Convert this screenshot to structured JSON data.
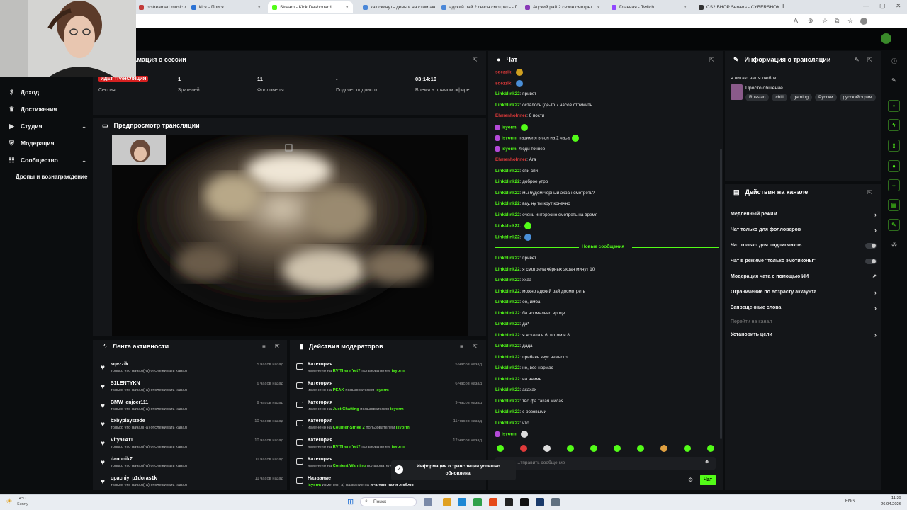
{
  "browser": {
    "tabs": [
      {
        "label": "p streamed music ×",
        "color": "#c23b3b"
      },
      {
        "label": "kick - Поиск",
        "color": "#2b72d4"
      },
      {
        "label": "Stream - Kick Dashboard",
        "color": "#53fc18",
        "active": true
      },
      {
        "label": "как скинуть деньги на стим акку",
        "color": "#4a87d8"
      },
      {
        "label": "адский рай 2 сезон смотреть - П",
        "color": "#4a87d8"
      },
      {
        "label": "Адский рай 2 сезон смотрет",
        "color": "#8a3bb8"
      },
      {
        "label": "Главная - Twitch",
        "color": "#9146ff"
      },
      {
        "label": "CS2 BHOP Servers - CYBERSHOKE",
        "color": "#333333"
      }
    ],
    "new_tab": "+"
  },
  "sidebar": {
    "items": [
      {
        "label": "Доход",
        "icon": "coin-icon"
      },
      {
        "label": "Достижения",
        "icon": "trophy-icon"
      },
      {
        "label": "Студия",
        "icon": "studio-icon",
        "expandable": true
      },
      {
        "label": "Модерация",
        "icon": "shield-icon"
      },
      {
        "label": "Сообщество",
        "icon": "people-icon",
        "expandable": true
      },
      {
        "label": "Дропы и вознаграждение",
        "icon": ""
      }
    ],
    "partial_hidden": "...трансляции"
  },
  "session": {
    "title": "...мация о сессии",
    "live_badge": "ИДЕТ ТРАНСЛЯЦИЯ",
    "stats": [
      {
        "value": "",
        "label": "Сессия"
      },
      {
        "value": "1",
        "label": "Зрителей"
      },
      {
        "value": "11",
        "label": "Фолловеры"
      },
      {
        "value": "-",
        "label": "Подсчет подписок"
      },
      {
        "value": "03:14:10",
        "label": "Время в прямом эфире"
      }
    ]
  },
  "preview": {
    "title": "Предпросмотр трансляции"
  },
  "activity": {
    "title": "Лента активности",
    "rows": [
      {
        "name": "sqezzik",
        "sub": "только что начал(-а) отслеживать канал",
        "time": "5 часов назад"
      },
      {
        "name": "S1LENTYKN",
        "sub": "только что начал(-а) отслеживать канал",
        "time": "6 часов назад"
      },
      {
        "name": "BMW_enjoer111",
        "sub": "только что начал(-а) отслеживать канал",
        "time": "9 часов назад"
      },
      {
        "name": "bxbyplaystede",
        "sub": "только что начал(-а) отслеживать канал",
        "time": "10 часов назад"
      },
      {
        "name": "Vitya1411",
        "sub": "только что начал(-а) отслеживать канал",
        "time": "10 часов назад"
      },
      {
        "name": "danonik7",
        "sub": "только что начал(-а) отслеживать канал",
        "time": "11 часов назад"
      },
      {
        "name": "opacniy_p1doras1k",
        "sub": "только что начал(-а) отслеживать канал",
        "time": "11 часов назад"
      }
    ]
  },
  "moderators": {
    "title": "Действия модераторов",
    "rows": [
      {
        "name": "Категория",
        "pre": "изменено на ",
        "val": "RV There Yet?",
        "mid": " пользователем ",
        "user": "isyorm",
        "time": "5 часов назад"
      },
      {
        "name": "Категория",
        "pre": "изменено на ",
        "val": "PEAK",
        "mid": " пользователем ",
        "user": "isyorm",
        "time": "6 часов назад"
      },
      {
        "name": "Категория",
        "pre": "изменено на ",
        "val": "Just Chatting",
        "mid": " пользователем ",
        "user": "isyorm",
        "time": "9 часов назад"
      },
      {
        "name": "Категория",
        "pre": "изменено на ",
        "val": "Counter-Strike 2",
        "mid": " пользователем ",
        "user": "isyorm",
        "time": "11 часов назад"
      },
      {
        "name": "Категория",
        "pre": "изменено на ",
        "val": "RV There Yet?",
        "mid": " пользователем ",
        "user": "isyorm",
        "time": "12 часов назад"
      },
      {
        "name": "Категория",
        "pre": "изменено на ",
        "val": "Content Warning",
        "mid": " пользователем ",
        "user": "isyorm",
        "time": ""
      },
      {
        "name": "Название",
        "pre": "",
        "val": "isyorm",
        "mid": " изменен(-а) название на ",
        "user": "я читаю чат я люблю",
        "time": ""
      }
    ]
  },
  "chat": {
    "title": "Чат",
    "lines_before": [
      {
        "user": "sqezzik",
        "color": "#e03a3a",
        "text": "",
        "emote": "#d0a020"
      },
      {
        "user": "sqezzik",
        "color": "#e03a3a",
        "text": "",
        "emote": "#4a8fd8"
      },
      {
        "user": "Linkblink22",
        "color": "#53fc18",
        "text": "привет"
      },
      {
        "user": "Linkblink22",
        "color": "#53fc18",
        "text": "осталось где-то 7 часов стримить"
      },
      {
        "user": "Ehmenholnner",
        "color": "#e03a3a",
        "text": "6 пости"
      },
      {
        "user": "isyorm",
        "color": "#53fc18",
        "text": "",
        "badge": true,
        "emote": "#53fc18"
      },
      {
        "user": "isyorm",
        "color": "#53fc18",
        "text": "пацики я в сон на 2 часа",
        "badge": true,
        "emote": "#53fc18"
      },
      {
        "user": "isyorm",
        "color": "#53fc18",
        "text": "люди точнее",
        "badge": true
      },
      {
        "user": "Ehmenholnner",
        "color": "#e03a3a",
        "text": "Ага"
      },
      {
        "user": "Linkblink22",
        "color": "#53fc18",
        "text": "спи спи"
      },
      {
        "user": "Linkblink22",
        "color": "#53fc18",
        "text": "доброе утро"
      },
      {
        "user": "Linkblink22",
        "color": "#53fc18",
        "text": "мы будем черный экран смотреть?"
      },
      {
        "user": "Linkblink22",
        "color": "#53fc18",
        "text": "вау, ну ты крут конечно"
      },
      {
        "user": "Linkblink22",
        "color": "#53fc18",
        "text": "очень интересно смотреть на время"
      },
      {
        "user": "Linkblink22",
        "color": "#53fc18",
        "text": "",
        "emote": "#53fc18"
      },
      {
        "user": "Linkblink22",
        "color": "#53fc18",
        "text": "",
        "emote": "#4a8fd8"
      }
    ],
    "new_messages": "Новые сообщения",
    "lines_after": [
      {
        "user": "Linkblink22",
        "color": "#53fc18",
        "text": "привет"
      },
      {
        "user": "Linkblink22",
        "color": "#53fc18",
        "text": "я смотрела чёрных экран минут 10"
      },
      {
        "user": "Linkblink22",
        "color": "#53fc18",
        "text": "ххаз"
      },
      {
        "user": "Linkblink22",
        "color": "#53fc18",
        "text": "можно адский рай досмотреть"
      },
      {
        "user": "Linkblink22",
        "color": "#53fc18",
        "text": "оо, имба"
      },
      {
        "user": "Linkblink22",
        "color": "#53fc18",
        "text": "ба нормально вроде"
      },
      {
        "user": "Linkblink22",
        "color": "#53fc18",
        "text": "да*"
      },
      {
        "user": "Linkblink22",
        "color": "#53fc18",
        "text": "я встала в 6, потом в 8"
      },
      {
        "user": "Linkblink22",
        "color": "#53fc18",
        "text": "дада"
      },
      {
        "user": "Linkblink22",
        "color": "#53fc18",
        "text": "прибавь звук немного"
      },
      {
        "user": "Linkblink22",
        "color": "#53fc18",
        "text": "не, все нормас"
      },
      {
        "user": "Linkblink22",
        "color": "#53fc18",
        "text": "на аниме"
      },
      {
        "user": "Linkblink22",
        "color": "#53fc18",
        "text": "ахахах"
      },
      {
        "user": "Linkblink22",
        "color": "#53fc18",
        "text": "тво фа такая милая"
      },
      {
        "user": "Linkblink22",
        "color": "#53fc18",
        "text": "с розовыми"
      },
      {
        "user": "Linkblink22",
        "color": "#53fc18",
        "text": "что"
      },
      {
        "user": "isyorm",
        "color": "#53fc18",
        "text": "",
        "badge": true,
        "emote": "#dddddd"
      }
    ],
    "emote_bar": [
      "#53fc18",
      "#e03a3a",
      "#dddddd",
      "#53fc18",
      "#53fc18",
      "#53fc18",
      "#53fc18",
      "#e0a040",
      "#53fc18",
      "#53fc18"
    ],
    "input_placeholder": "...тправить сообщение",
    "send_label": "Чат"
  },
  "toast": {
    "text_line1": "Информация о трансляции успешно",
    "text_line2": "обновлена."
  },
  "stream_info": {
    "title": "Информация о трансляции",
    "stream_title": "я читаю чат я люблю",
    "category": "Просто общение",
    "tags": [
      "Russian",
      "chill",
      "gaming",
      "Русски",
      "русскийстрим"
    ]
  },
  "channel_actions": {
    "title": "Действия на канале",
    "items": [
      {
        "label": "Медленный режим",
        "control": "chevron"
      },
      {
        "label": "Чат только для фолловеров",
        "control": "chevron"
      },
      {
        "label": "Чат только для подписчиков",
        "control": "toggle"
      },
      {
        "label": "Чат в режиме \"только эмотиконы\"",
        "control": "toggle"
      },
      {
        "label": "Модерация чата с помощью ИИ",
        "control": "external"
      },
      {
        "label": "Ограничение по возрасту аккаунта",
        "control": "chevron"
      },
      {
        "label": "Запрещенные слова",
        "control": "chevron"
      },
      {
        "label": "Перейти на канал",
        "control": "none",
        "muted": true
      },
      {
        "label": "Установить цели",
        "control": "chevron"
      }
    ]
  },
  "taskbar": {
    "weather_temp": "14°C",
    "weather_text": "Sunny",
    "search": "Поиск",
    "lang": "ENG",
    "time": "11:39",
    "date": "26.04.2026"
  },
  "colors": {
    "accent": "#53fc18",
    "live": "#d62020",
    "panel": "#141619",
    "bg": "#0b0d0f"
  }
}
